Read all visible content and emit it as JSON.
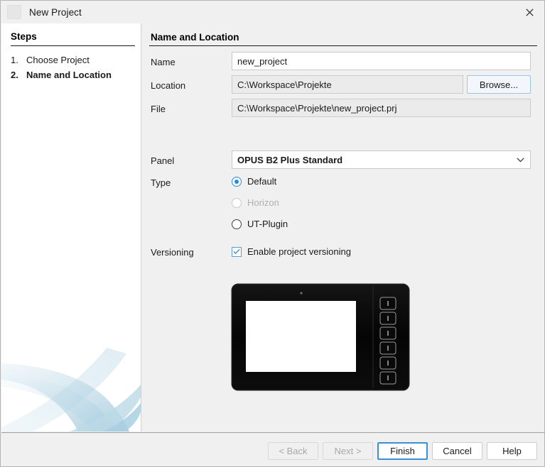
{
  "window": {
    "title": "New Project",
    "close_label": "✕",
    "app_icon": "blank-app-icon"
  },
  "steps_pane": {
    "heading": "Steps",
    "items": [
      {
        "number": "1.",
        "label": "Choose Project",
        "current": false
      },
      {
        "number": "2.",
        "label": "Name and Location",
        "current": true
      }
    ]
  },
  "content": {
    "heading": "Name and Location",
    "fields": {
      "name": {
        "label": "Name",
        "value": "new_project",
        "placeholder": ""
      },
      "location": {
        "label": "Location",
        "value": "C:\\Workspace\\Projekte"
      },
      "browse": {
        "label": "Browse..."
      },
      "file": {
        "label": "File",
        "value": "C:\\Workspace\\Projekte\\new_project.prj"
      },
      "panel": {
        "label": "Panel",
        "selected": "OPUS B2 Plus Standard",
        "chevron": "chevron-down-icon"
      },
      "type": {
        "label": "Type",
        "options": [
          {
            "label": "Default",
            "selected": true,
            "disabled": false
          },
          {
            "label": "Horizon",
            "selected": false,
            "disabled": true
          },
          {
            "label": "UT-Plugin",
            "selected": false,
            "disabled": false
          }
        ]
      },
      "versioning": {
        "label": "Versioning",
        "checkbox_label": "Enable project versioning",
        "checked": true
      }
    },
    "preview": {
      "name": "panel-device-preview",
      "side_button_count": 6
    }
  },
  "footer": {
    "buttons": [
      {
        "label": "< Back",
        "disabled": true,
        "primary": false
      },
      {
        "label": "Next >",
        "disabled": true,
        "primary": false
      },
      {
        "label": "Finish",
        "disabled": false,
        "primary": true
      },
      {
        "label": "Cancel",
        "disabled": false,
        "primary": false
      },
      {
        "label": "Help",
        "disabled": false,
        "primary": false
      }
    ]
  },
  "colors": {
    "accent": "#3b8fd4",
    "window_bg": "#f0f0f0",
    "pane_bg": "#ffffff",
    "swoosh": "#b9d7e5"
  }
}
